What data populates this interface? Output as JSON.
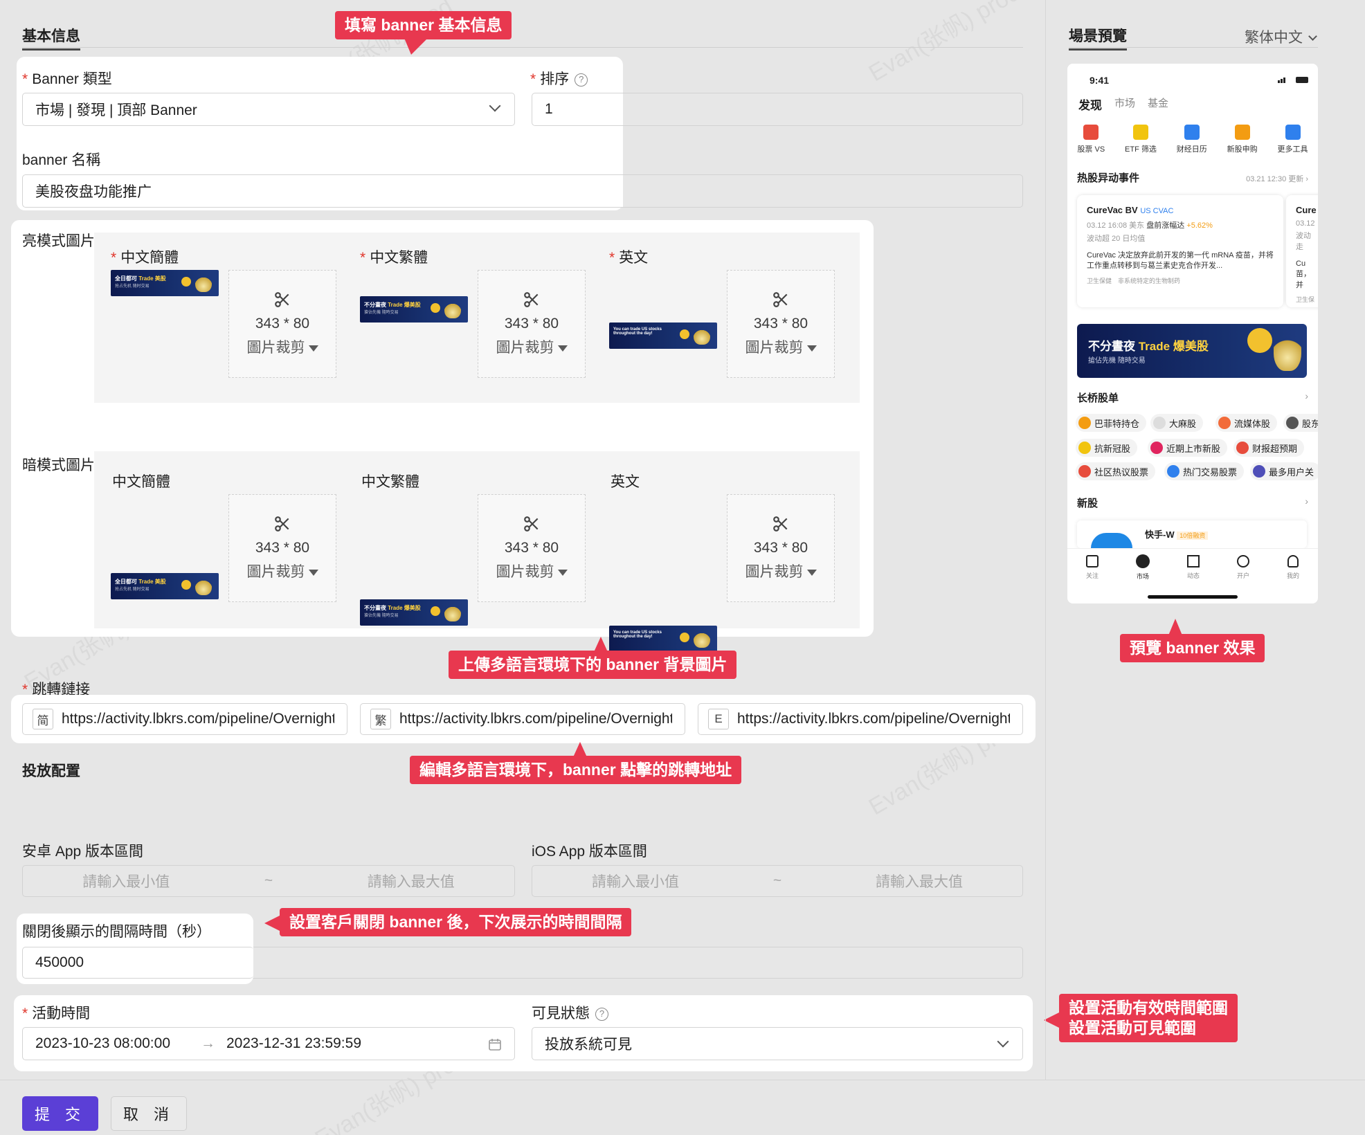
{
  "basic_info": {
    "section_title": "基本信息",
    "banner_type_label": "Banner 類型",
    "banner_type_value": "市場 | 發現 | 頂部 Banner",
    "order_label": "排序",
    "order_value": "1",
    "banner_name_label": "banner 名稱",
    "banner_name_value": "美股夜盘功能推广"
  },
  "images": {
    "light_label": "亮模式圖片",
    "dark_label": "暗模式圖片",
    "lang_simplified": "中文簡體",
    "lang_traditional": "中文繁體",
    "lang_english": "英文",
    "crop_size": "343 * 80",
    "crop_action": "圖片裁剪",
    "thumb_simplified": {
      "pre": "全日都可 ",
      "hl": "Trade 美股",
      "sub": "抢占先机 随时交易"
    },
    "thumb_traditional": {
      "pre": "不分晝夜 ",
      "hl": "Trade 爆美股",
      "sub": "搶佔先機 隨時交易"
    },
    "thumb_english": {
      "pre": "You can trade US stocks",
      "hl": "",
      "sub": "throughout the day!"
    }
  },
  "jump_link": {
    "label": "跳轉鏈接",
    "prefix_sc": "简",
    "prefix_tc": "繁",
    "prefix_en": "E",
    "url_sc": "https://activity.lbkrs.com/pipeline/Overnight",
    "url_tc": "https://activity.lbkrs.com/pipeline/Overnight",
    "url_en": "https://activity.lbkrs.com/pipeline/Overnight"
  },
  "delivery": {
    "section_title": "投放配置",
    "android_label": "安卓 App 版本區間",
    "ios_label": "iOS App 版本區間",
    "min_placeholder": "請輸入最小值",
    "max_placeholder": "請輸入最大值",
    "range_sep": "~",
    "interval_label": "關閉後顯示的間隔時間（秒）",
    "interval_value": "450000",
    "activity_time_label": "活動時間",
    "start_time": "2023-10-23 08:00:00",
    "end_time": "2023-12-31 23:59:59",
    "range_arrow": "→",
    "visibility_label": "可見狀態",
    "visibility_value": "投放系統可見"
  },
  "footer": {
    "submit": "提 交",
    "cancel": "取 消"
  },
  "preview": {
    "title": "場景預覽",
    "lang_select": "繁体中文",
    "status_time": "9:41",
    "tabs": [
      "发现",
      "市场",
      "基金"
    ],
    "tools": [
      "股票 VS",
      "ETF 筛选",
      "财经日历",
      "新股申购",
      "更多工具"
    ],
    "hot_title": "热股异动事件",
    "hot_update": "03.21 12:30 更新",
    "card_name": "CureVac BV",
    "card_ticker": "US CVAC",
    "card_meta": "03.12 16:08 美东",
    "card_status": "盘前涨幅达",
    "card_pct": "+5.62%",
    "card_line2": "波动超 20 日均值",
    "card_desc": "CureVac 决定放弃此前开发的第一代 mRNA 疫苗，并将工作重点转移到与葛兰素史克合作开发...",
    "card_tags": [
      "卫生保健",
      "非系统特定的生物制药"
    ],
    "card2_name": "Cure",
    "card2_meta": "03.12",
    "card2_line2": "波动走",
    "card2_desc": "Cu",
    "card2_desc2": "苗，并",
    "card2_tag": "卫生保",
    "banner_text": "不分晝夜",
    "banner_hl": "Trade 爆美股",
    "banner_sub": "搶佔先機 隨時交易",
    "longbridge_title": "长桥股单",
    "chips_row1": [
      "巴菲特持仓",
      "大麻股",
      "流媒体股",
      "股东"
    ],
    "chips_row2": [
      "抗新冠股",
      "近期上市新股",
      "财报超预期"
    ],
    "chips_row3": [
      "社区热议股票",
      "热门交易股票",
      "最多用户关"
    ],
    "ipo_title": "新股",
    "ipo_name": "快手-W",
    "ipo_badge": "10倍融资",
    "nav": [
      "关注",
      "市场",
      "动态",
      "开户",
      "我的"
    ]
  },
  "callouts": {
    "basic": "填寫 banner 基本信息",
    "images": "上傳多語言環境下的 banner 背景圖片",
    "links": "編輯多語言環境下，banner 點擊的跳轉地址",
    "interval": "設置客戶關閉 banner 後，下次展示的時間間隔",
    "time_line1": "設置活動有效時間範圍",
    "time_line2": "設置活動可見範圍",
    "preview": "預覽 banner 效果"
  },
  "colors": {
    "callout": "#e8384f",
    "primary_button": "#5b3fd6",
    "required_star": "#e0352b"
  }
}
